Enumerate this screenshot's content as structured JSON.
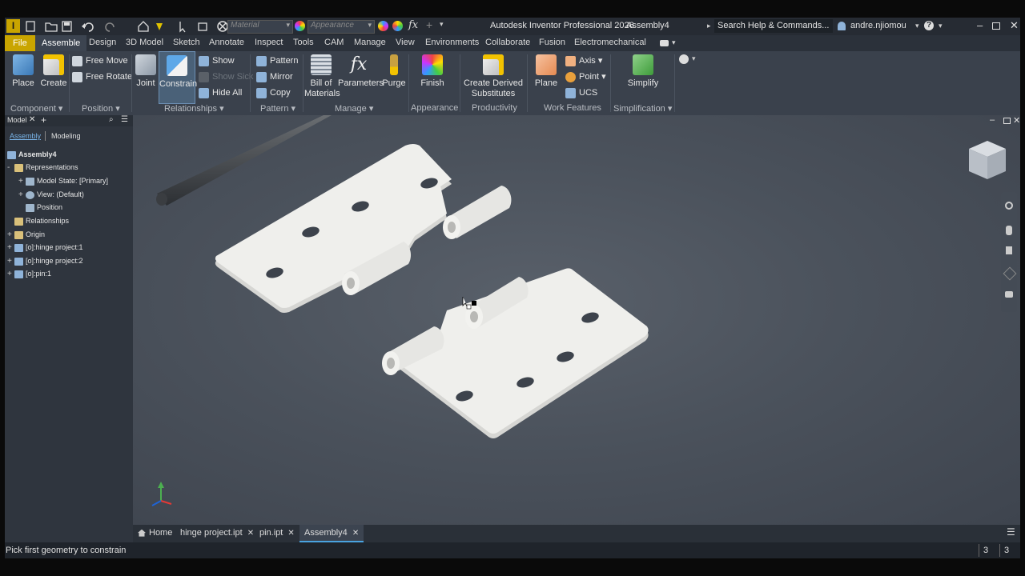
{
  "titlebar": {
    "app_icon": "I",
    "material_placeholder": "Material",
    "appearance_placeholder": "Appearance",
    "window_title": "Autodesk Inventor Professional 2026",
    "document": "Assembly4",
    "search": "Search Help & Commands...",
    "user": "andre.njiomou"
  },
  "tabs": [
    "File",
    "Assemble",
    "Design",
    "3D Model",
    "Sketch",
    "Annotate",
    "Inspect",
    "Tools",
    "CAM",
    "Manage",
    "View",
    "Environments",
    "Collaborate",
    "Fusion",
    "Electromechanical"
  ],
  "ribbon": {
    "component": {
      "place": "Place",
      "create": "Create",
      "label": "Component"
    },
    "position": {
      "free_move": "Free Move",
      "free_rotate": "Free Rotate",
      "label": "Position"
    },
    "relationships": {
      "joint": "Joint",
      "constrain": "Constrain",
      "show": "Show",
      "show_sick": "Show Sick",
      "hide_all": "Hide All",
      "label": "Relationships"
    },
    "pattern": {
      "pattern": "Pattern",
      "mirror": "Mirror",
      "copy": "Copy",
      "label": "Pattern"
    },
    "manage": {
      "bom_line1": "Bill of",
      "bom_line2": "Materials",
      "parameters": "Parameters",
      "purge": "Purge",
      "label": "Manage"
    },
    "appearance": {
      "finish": "Finish",
      "label": "Appearance"
    },
    "productivity": {
      "derived_line1": "Create Derived",
      "derived_line2": "Substitutes",
      "label": "Productivity"
    },
    "work_features": {
      "plane": "Plane",
      "axis": "Axis",
      "point": "Point",
      "ucs": "UCS",
      "label": "Work Features"
    },
    "simplification": {
      "simplify": "Simplify",
      "label": "Simplification"
    }
  },
  "browser": {
    "tab_model": "Model",
    "sub_assembly": "Assembly",
    "sub_modeling": "Modeling",
    "items": [
      {
        "label": "Assembly4",
        "level": 0,
        "expander": ""
      },
      {
        "label": "Representations",
        "level": 0,
        "expander": "-"
      },
      {
        "label": "Model State: [Primary]",
        "level": 1,
        "expander": "+"
      },
      {
        "label": "View: (Default)",
        "level": 1,
        "expander": "+"
      },
      {
        "label": "Position",
        "level": 1,
        "expander": ""
      },
      {
        "label": "Relationships",
        "level": 0,
        "expander": ""
      },
      {
        "label": "Origin",
        "level": 0,
        "expander": "+"
      },
      {
        "label": "[o]:hinge project:1",
        "level": 0,
        "expander": "+"
      },
      {
        "label": "[o]:hinge project:2",
        "level": 0,
        "expander": "+"
      },
      {
        "label": "[o]:pin:1",
        "level": 0,
        "expander": "+"
      }
    ]
  },
  "doc_tabs": {
    "home": "Home",
    "tab1": "hinge project.ipt",
    "tab2": "pin.ipt",
    "tab3": "Assembly4"
  },
  "status": {
    "message": "Pick first geometry to constrain",
    "count1": "3",
    "count2": "3"
  },
  "colors": {
    "accent": "#c9a500",
    "active_tab": "#3c4450",
    "part": "#e6e6e3"
  }
}
